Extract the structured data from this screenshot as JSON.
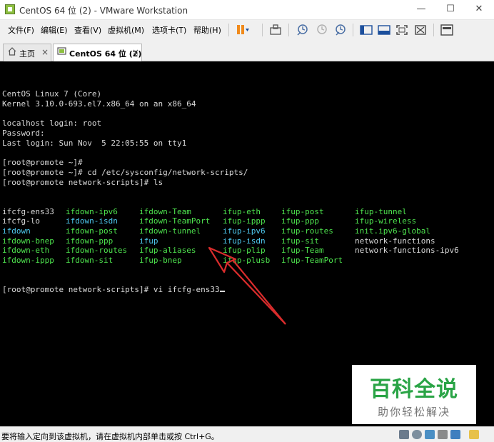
{
  "window": {
    "title": "CentOS 64 位 (2) - VMware Workstation",
    "minimize": "—",
    "maximize": "☐",
    "close": "✕"
  },
  "menu": [
    "文件(F)",
    "编辑(E)",
    "查看(V)",
    "虚拟机(M)",
    "选项卡(T)",
    "帮助(H)"
  ],
  "tabs": [
    {
      "label": "主页",
      "close": "×"
    },
    {
      "label": "CentOS 64 位 (2)",
      "close": "×"
    }
  ],
  "terminal": {
    "header_lines": [
      "CentOS Linux 7 (Core)",
      "Kernel 3.10.0-693.el7.x86_64 on an x86_64",
      "",
      "localhost login: root",
      "Password:",
      "Last login: Sun Nov  5 22:05:55 on tty1",
      "",
      "[root@promote ~]#",
      "[root@promote ~]# cd /etc/sysconfig/network-scripts/",
      "[root@promote network-scripts]# ls"
    ],
    "ls_rows": [
      [
        "ifcfg-ens33",
        "ifdown-ipv6",
        "ifdown-Team",
        "ifup-eth",
        "ifup-post",
        "ifup-tunnel"
      ],
      [
        "ifcfg-lo",
        "ifdown-isdn",
        "ifdown-TeamPort",
        "ifup-ippp",
        "ifup-ppp",
        "ifup-wireless"
      ],
      [
        "ifdown",
        "ifdown-post",
        "ifdown-tunnel",
        "ifup-ipv6",
        "ifup-routes",
        "init.ipv6-global"
      ],
      [
        "ifdown-bnep",
        "ifdown-ppp",
        "ifup",
        "ifup-isdn",
        "ifup-sit",
        "network-functions"
      ],
      [
        "ifdown-eth",
        "ifdown-routes",
        "ifup-aliases",
        "ifup-plip",
        "ifup-Team",
        "network-functions-ipv6"
      ],
      [
        "ifdown-ippp",
        "ifdown-sit",
        "ifup-bnep",
        "ifup-plusb",
        "ifup-TeamPort",
        ""
      ]
    ],
    "ls_colors": [
      [
        "w",
        "g",
        "g",
        "g",
        "g",
        "g"
      ],
      [
        "w",
        "c",
        "g",
        "g",
        "g",
        "g"
      ],
      [
        "c",
        "g",
        "g",
        "c",
        "g",
        "g"
      ],
      [
        "g",
        "g",
        "c",
        "c",
        "g",
        "w"
      ],
      [
        "g",
        "g",
        "g",
        "g",
        "g",
        "w"
      ],
      [
        "g",
        "g",
        "g",
        "g",
        "g",
        "w"
      ]
    ],
    "last_line": "[root@promote network-scripts]# vi ifcfg-ens33"
  },
  "watermark": {
    "title": "百科全说",
    "subtitle": "助你轻松解决"
  },
  "status": {
    "text": "要将输入定向到该虚拟机，请在虚拟机内部单击或按 Ctrl+G。"
  },
  "colors": {
    "terminal_bg": "#000000",
    "terminal_text": "#d9d9d9",
    "exec_green": "#4ee44e",
    "link_cyan": "#4fc9f0",
    "arrow_red": "#d92c2c",
    "watermark_green": "#2aa446"
  }
}
